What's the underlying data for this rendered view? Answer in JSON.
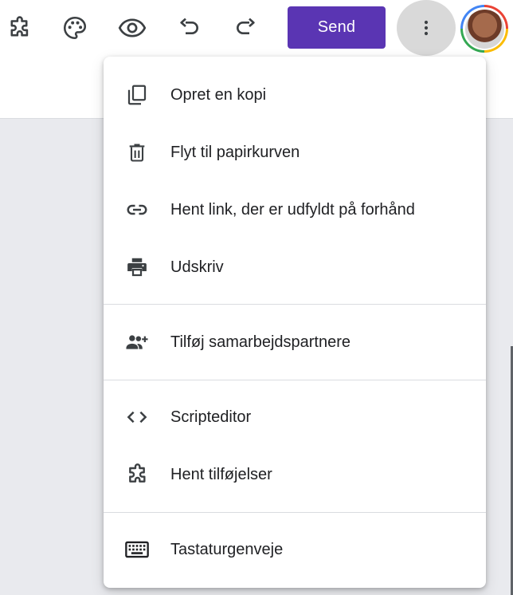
{
  "toolbar": {
    "addons_icon": "puzzle-icon",
    "palette_icon": "palette-icon",
    "preview_icon": "eye-icon",
    "undo_icon": "undo-icon",
    "redo_icon": "redo-icon",
    "send_label": "Send",
    "more_icon": "more-vert-icon",
    "send_color": "#5a35b3"
  },
  "menu": {
    "items": [
      {
        "label": "Opret en kopi",
        "icon": "copy-icon"
      },
      {
        "label": "Flyt til papirkurven",
        "icon": "trash-icon"
      },
      {
        "label": "Hent link, der er udfyldt på forhånd",
        "icon": "link-icon"
      },
      {
        "label": "Udskriv",
        "icon": "print-icon"
      },
      {
        "label": "Tilføj samarbejdspartnere",
        "icon": "add-people-icon"
      },
      {
        "label": "Scripteditor",
        "icon": "code-icon"
      },
      {
        "label": "Hent tilføjelser",
        "icon": "puzzle-icon"
      },
      {
        "label": "Tastaturgenveje",
        "icon": "keyboard-icon"
      }
    ]
  }
}
